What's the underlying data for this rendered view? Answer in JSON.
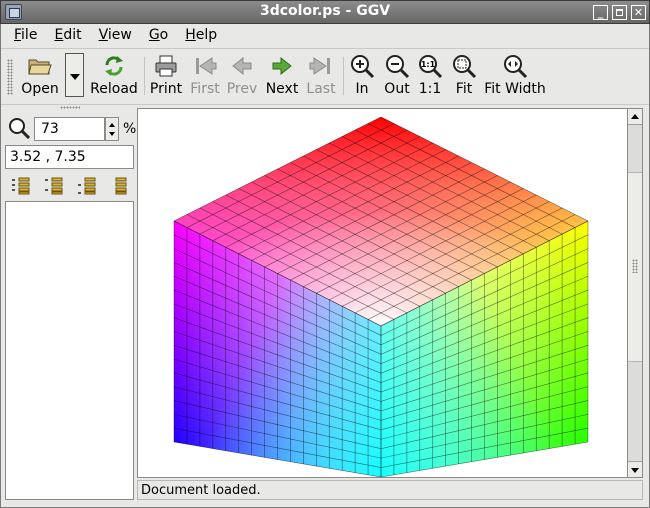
{
  "window": {
    "title": "3dcolor.ps - GGV",
    "controls": [
      "minimize",
      "maximize",
      "close"
    ]
  },
  "menu": [
    {
      "label": "File",
      "mnemonic": "F",
      "rest": "ile"
    },
    {
      "label": "Edit",
      "mnemonic": "E",
      "rest": "dit"
    },
    {
      "label": "View",
      "mnemonic": "V",
      "rest": "iew"
    },
    {
      "label": "Go",
      "mnemonic": "G",
      "rest": "o"
    },
    {
      "label": "Help",
      "mnemonic": "H",
      "rest": "elp"
    }
  ],
  "toolbar": {
    "open": "Open",
    "reload": "Reload",
    "print": "Print",
    "first": "First",
    "prev": "Prev",
    "next": "Next",
    "last": "Last",
    "zoom_in": "In",
    "zoom_out": "Out",
    "zoom_1to1": "1:1",
    "fit": "Fit",
    "fit_width": "Fit Width",
    "disabled": [
      "First",
      "Prev",
      "Last"
    ]
  },
  "sidebar": {
    "zoom_value": "73",
    "zoom_unit": "%",
    "coordinates": "3.52 , 7.35",
    "mark_buttons": [
      "mark-all-icon",
      "mark-even-icon",
      "mark-odd-icon",
      "unmark-all-icon"
    ]
  },
  "status": {
    "text": "Document loaded."
  },
  "colors": {
    "titlebar": "#7a7a7a",
    "chrome": "#e8e8e6",
    "document_bg": "#ffffff",
    "cube_top_corner": "#ff0000",
    "cube_left_top": "#ff00ff",
    "cube_right_top": "#ffff00",
    "cube_left_bottom": "#0000ff",
    "cube_right_bottom": "#00ff00",
    "cube_bottom": "#00ffff",
    "cube_center": "#ffffff"
  },
  "document": {
    "content": "RGB color cube",
    "grid_divisions": 16
  }
}
